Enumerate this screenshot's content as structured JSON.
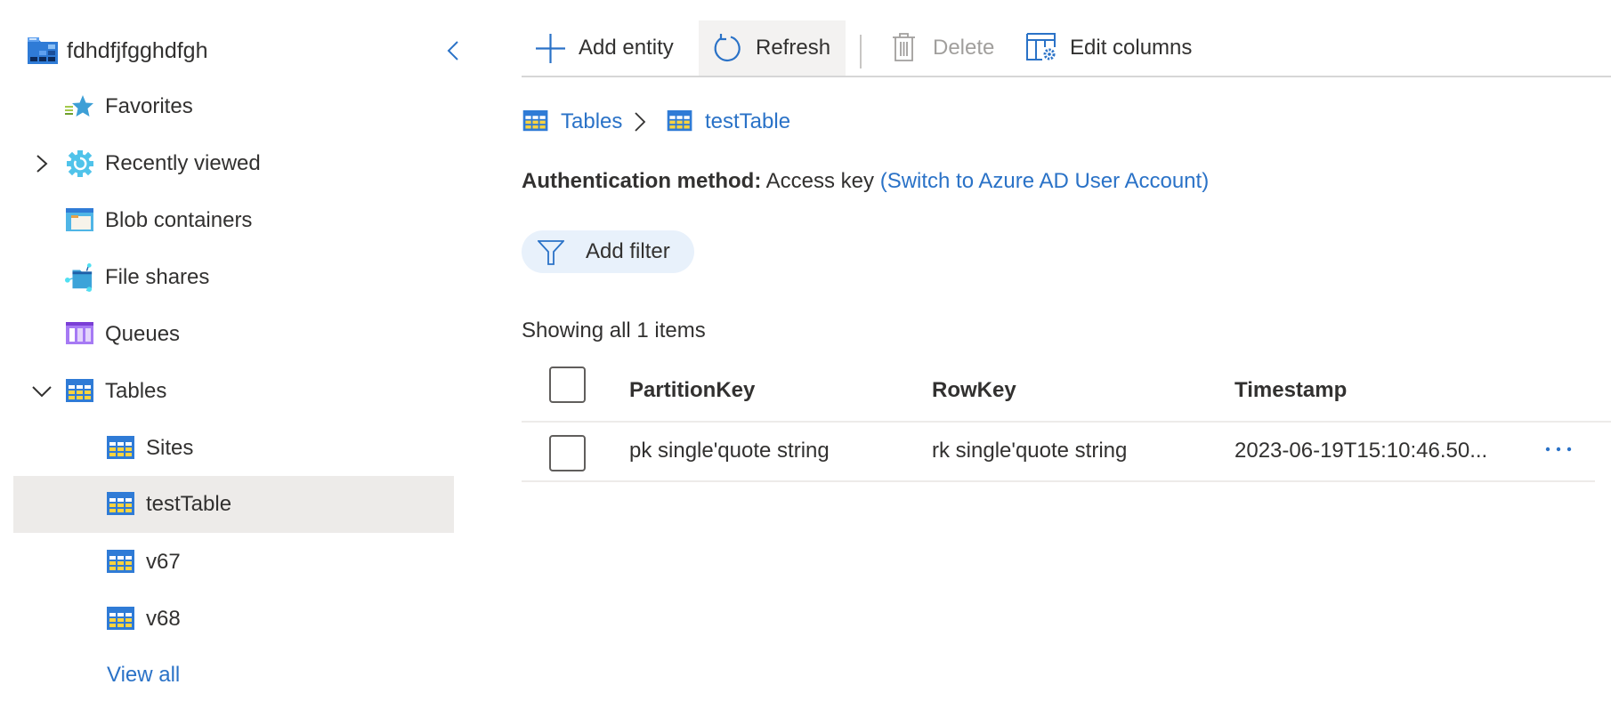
{
  "sidebar": {
    "account_name": "fdhdfjfgghdfgh",
    "collapse_icon": "chevron-left-icon",
    "items": [
      {
        "label": "Favorites",
        "icon": "favorites-star-icon"
      },
      {
        "label": "Recently viewed",
        "icon": "recent-gear-icon",
        "expander": "chevron-right-icon"
      },
      {
        "label": "Blob containers",
        "icon": "blob-container-icon"
      },
      {
        "label": "File shares",
        "icon": "file-share-icon"
      },
      {
        "label": "Queues",
        "icon": "queue-icon"
      },
      {
        "label": "Tables",
        "icon": "table-icon",
        "expander": "chevron-down-icon"
      }
    ],
    "tables": [
      {
        "label": "Sites",
        "selected": false
      },
      {
        "label": "testTable",
        "selected": true
      },
      {
        "label": "v67",
        "selected": false
      },
      {
        "label": "v68",
        "selected": false
      }
    ],
    "view_all": "View all"
  },
  "toolbar": {
    "add_entity": "Add entity",
    "refresh": "Refresh",
    "delete": "Delete",
    "edit_columns": "Edit columns"
  },
  "breadcrumb": {
    "root": "Tables",
    "current": "testTable"
  },
  "auth": {
    "label": "Authentication method:",
    "value": "Access key",
    "switch_link": "(Switch to Azure AD User Account)"
  },
  "filter": {
    "add_filter": "Add filter"
  },
  "results": {
    "count_text": "Showing all 1 items"
  },
  "table": {
    "columns": [
      "PartitionKey",
      "RowKey",
      "Timestamp"
    ],
    "rows": [
      {
        "PartitionKey": "pk single'quote string",
        "RowKey": "rk single'quote string",
        "Timestamp": "2023-06-19T15:10:46.50...",
        "more": "···"
      }
    ]
  },
  "colors": {
    "accent": "#2a72c7",
    "text": "#323130",
    "disabled": "#a19f9d",
    "selected_bg": "#edebe9",
    "filter_pill_bg": "#e8f1fb",
    "refresh_hover_bg": "#f3f2f1"
  }
}
